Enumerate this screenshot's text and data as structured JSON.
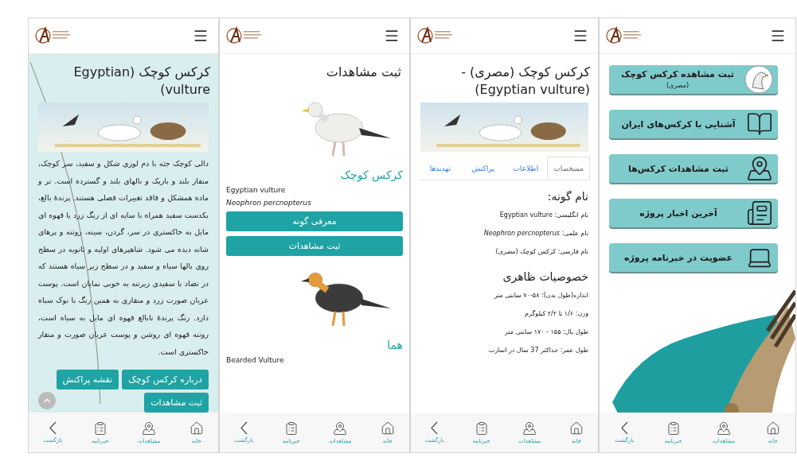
{
  "screens": [
    {
      "kind": "home_menu",
      "menu": [
        {
          "label": "ثبت مشاهده کرکس کوچک",
          "note": "(مصری)"
        },
        {
          "label": "آشنایی با کرکس‌های ایران"
        },
        {
          "label": "ثبت مشاهدات  کرکس‌ها"
        },
        {
          "label": "آخرین اخبار پروژه"
        },
        {
          "label": "عضویت در خبرنامه پروژه"
        }
      ],
      "nav": [
        {
          "label": "خانه"
        },
        {
          "label": "مشاهدات"
        },
        {
          "label": "خبرنامه"
        },
        {
          "label": "بازگشت"
        }
      ]
    },
    {
      "kind": "species_detail",
      "title": "کرکس کوچک (مصری) -(Egyptian vulture)",
      "tabs": [
        {
          "label": "مشخصات",
          "selected": true
        },
        {
          "label": "اطلاعات",
          "selected": false
        },
        {
          "label": "پراکنش",
          "selected": false
        },
        {
          "label": "تهدیدها",
          "selected": false
        }
      ],
      "sections": [
        {
          "heading": "نام گونه:",
          "lines": [
            "نام انگلیسی: Egyptian vulture",
            "نام علمی: *Neophron percnopterus*",
            "نام فارسی: کرکس کوچک (مصری)"
          ]
        },
        {
          "heading": "خصوصیات ظاهری",
          "lines": [
            "اندازه(طول بدن): ۵۸-۷۰ سانتی متر",
            "وزن: ۱/۶ تا ۲/۲ کیلوگرم",
            "طول بال: ۱۵۵ - ۱۷۰ سانتی متر",
            "طول عمر: حداکثر 37 سال در اسارت"
          ]
        }
      ],
      "nav": [
        {
          "label": "خانه"
        },
        {
          "label": "مشاهدات"
        },
        {
          "label": "خبرنامه"
        },
        {
          "label": "بازگشت"
        }
      ]
    },
    {
      "kind": "species_list",
      "title": "ثبت مشاهدات",
      "species": [
        {
          "name": "کرکس کوچک",
          "english": "Egyptian vulture",
          "scientific": "Neophron percnopterus",
          "buttons": [
            "معرفی گونه",
            "ثبت مشاهدات"
          ]
        },
        {
          "name": "هما",
          "english": "Bearded Vulture"
        }
      ],
      "nav": [
        {
          "label": "خانه"
        },
        {
          "label": "مشاهدات"
        },
        {
          "label": "خبرنامه"
        },
        {
          "label": "بازگشت"
        }
      ]
    },
    {
      "kind": "article",
      "title": "کرکس کوچک (Egyptian vulture)",
      "text": "دالی کوچک جثه با دم لوزی شکل و سفید، سر کوچک، منقار بلند و باریک و بالهای بلند و گسترده است. نر و ماده همشکل و فاقد تغییرات فصلی هستند. پرندهٔ بالغ، یکدست سفید همراه با سایه ای از رنگ زرد یا قهوه ای مایل به خاکستری در سر، گردن، سینه، روتنه و پرهای شانه دیده می شود. شاهپرهای اولیه و ثانویه در سطح روی بالها سیاه و سفید و در سطح زیر سیاه هستند که در تضاد با سفیدی زیرتنه به خوبی نمایان است. پوست عریان صورت زرد و منقاری به همین رنگ با نوک سیاه دارد. رنگ پرندهٔ نابالغ قهوه ای مایل به سیاه است، روتنه قهوه ای روشن و پوست عریان صورت و منقار خاکستری است.",
      "buttons": [
        "درباره کرکس کوچک",
        "نقشه پراکنش",
        "ثبت مشاهدات"
      ],
      "nav": [
        {
          "label": "خانه"
        },
        {
          "label": "مشاهدات"
        },
        {
          "label": "خبرنامه"
        },
        {
          "label": "بازگشت"
        }
      ]
    }
  ]
}
